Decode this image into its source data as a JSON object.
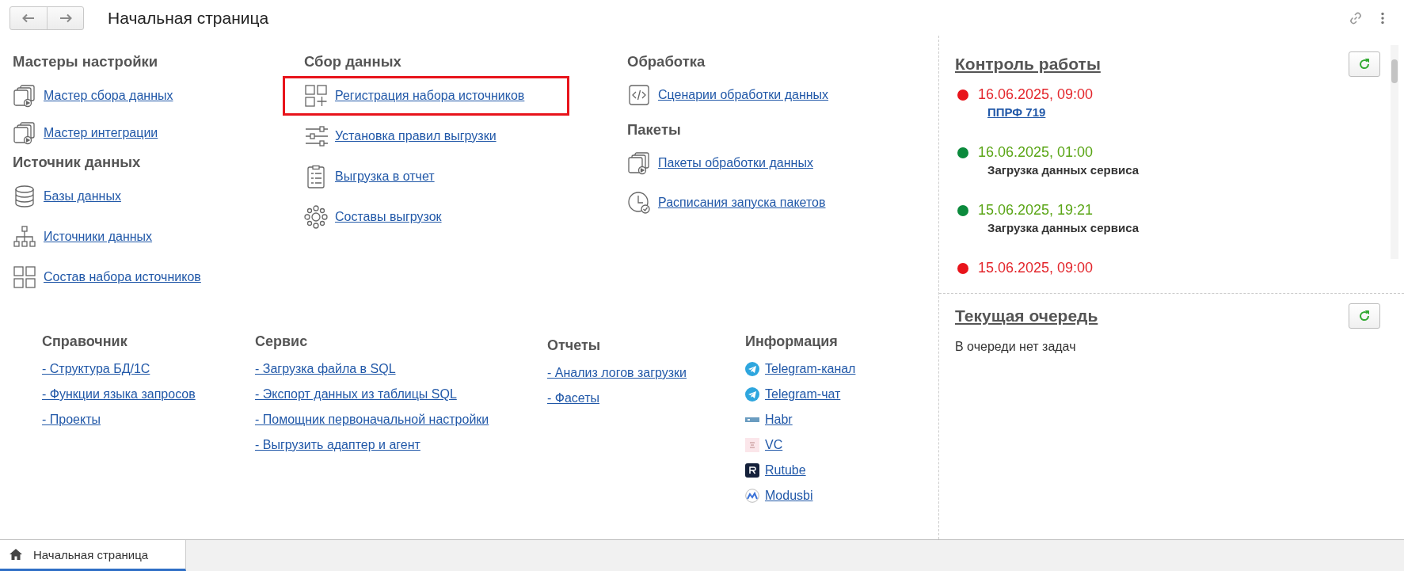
{
  "header": {
    "title": "Начальная страница"
  },
  "columns": [
    {
      "sections": [
        {
          "title": "Мастеры настройки",
          "items": [
            {
              "label": "Мастер сбора данных",
              "highlighted": false
            },
            {
              "label": "Мастер интеграции",
              "highlighted": false
            }
          ]
        },
        {
          "title": "Источник данных",
          "items": [
            {
              "label": "Базы данных",
              "highlighted": false
            },
            {
              "label": "Источники данных",
              "highlighted": false
            },
            {
              "label": "Состав набора источников",
              "highlighted": false
            }
          ]
        }
      ]
    },
    {
      "sections": [
        {
          "title": "Сбор данных",
          "items": [
            {
              "label": "Регистрация набора источников",
              "highlighted": true
            },
            {
              "label": "Установка правил выгрузки",
              "highlighted": false
            },
            {
              "label": "Выгрузка в отчет",
              "highlighted": false
            },
            {
              "label": "Составы выгрузок",
              "highlighted": false
            }
          ]
        }
      ]
    },
    {
      "sections": [
        {
          "title": "Обработка",
          "items": [
            {
              "label": "Сценарии обработки данных",
              "highlighted": false
            }
          ]
        },
        {
          "title": "Пакеты",
          "items": [
            {
              "label": "Пакеты обработки данных",
              "highlighted": false
            },
            {
              "label": "Расписания запуска пакетов",
              "highlighted": false
            }
          ]
        }
      ]
    }
  ],
  "footer_sections": [
    {
      "title": "Справочник",
      "links": [
        "- Структура БД/1С",
        "- Функции языка запросов",
        "- Проекты"
      ]
    },
    {
      "title": "Сервис",
      "links": [
        "- Загрузка файла в SQL",
        "- Экспорт данных из таблицы SQL",
        "- Помощник первоначальной настройки",
        "- Выгрузить адаптер и агент"
      ]
    },
    {
      "title": "Отчеты",
      "links": [
        "- Анализ логов загрузки",
        "- Фасеты"
      ]
    },
    {
      "title": "Информация",
      "links": [
        "Telegram-канал",
        "Telegram-чат",
        "Habr",
        "VC",
        "Rutube",
        "Modusbi"
      ]
    }
  ],
  "monitor": {
    "title": "Контроль работы",
    "events": [
      {
        "time": "16.06.2025, 09:00",
        "failed": true,
        "detail": {
          "kind": "link",
          "text": "ППРФ 719"
        }
      },
      {
        "time": "16.06.2025, 01:00",
        "failed": false,
        "detail": {
          "kind": "text",
          "text": "Загрузка данных сервиса"
        }
      },
      {
        "time": "15.06.2025, 19:21",
        "failed": false,
        "detail": {
          "kind": "text",
          "text": "Загрузка данных сервиса"
        }
      },
      {
        "time": "15.06.2025, 09:00",
        "failed": true
      }
    ]
  },
  "queue": {
    "title": "Текущая очередь",
    "message": "В очереди нет задач"
  },
  "taskbar": {
    "tabs": [
      {
        "label": "Начальная страница",
        "selected": true
      }
    ]
  }
}
